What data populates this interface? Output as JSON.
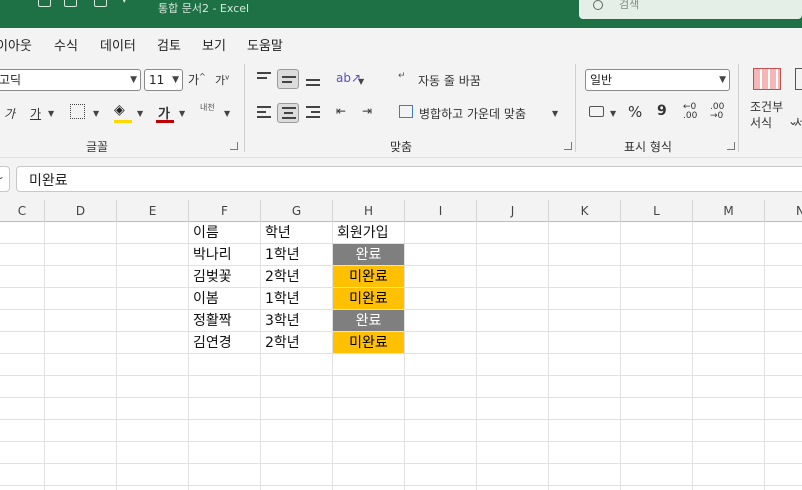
{
  "window": {
    "title": "통합 문서2 - Excel",
    "search_placeholder": "검색"
  },
  "menu": [
    "이아웃",
    "수식",
    "데이터",
    "검토",
    "보기",
    "도움말"
  ],
  "ribbon": {
    "font_name": "고딕",
    "font_size": "11",
    "grow_font": "가",
    "shrink_font": "가",
    "italic": "가",
    "underline": "가",
    "font_color_glyph": "가",
    "vertical_text": "내천",
    "wrap_text": "자동 줄 바꿈",
    "merge_center": "병합하고 가운데 맞춤",
    "number_format": "일반",
    "percent": "%",
    "comma": "9",
    "conditional_format_l1": "조건부",
    "conditional_format_l2": "서식",
    "groups": {
      "font": "글꼴",
      "alignment": "맞춤",
      "number": "표시 형식"
    }
  },
  "formula_bar": {
    "content": "미완료"
  },
  "columns": [
    "C",
    "D",
    "E",
    "F",
    "G",
    "H",
    "I",
    "J",
    "K",
    "L",
    "M",
    "N"
  ],
  "table": {
    "headers": [
      "이름",
      "학년",
      "회원가입"
    ],
    "rows": [
      {
        "name": "박나리",
        "grade": "1학년",
        "status": "완료"
      },
      {
        "name": "김벚꽃",
        "grade": "2학년",
        "status": "미완료"
      },
      {
        "name": "이봄",
        "grade": "1학년",
        "status": "미완료"
      },
      {
        "name": "정활짝",
        "grade": "3학년",
        "status": "완료"
      },
      {
        "name": "김연경",
        "grade": "2학년",
        "status": "미완료"
      }
    ]
  },
  "colors": {
    "title_bar": "#1e7145",
    "complete_fill": "#7f7f7f",
    "complete_text": "#ffffff",
    "incomplete_fill": "#ffc000",
    "incomplete_text": "#000000"
  }
}
